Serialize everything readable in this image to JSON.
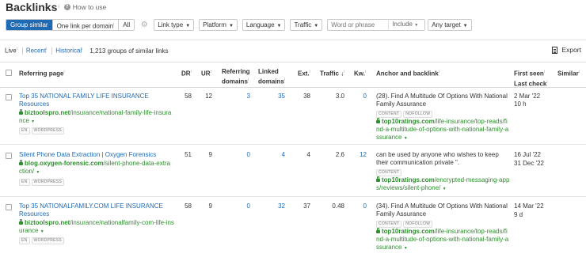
{
  "header": {
    "title": "Backlinks",
    "title_sup": "i",
    "howto": "How to use"
  },
  "filters": {
    "segments": [
      "Group similar",
      "One link per domain",
      "All"
    ],
    "link_type": "Link type",
    "platform": "Platform",
    "language": "Language",
    "traffic": "Traffic",
    "search_placeholder": "Word or phrase",
    "include": "Include",
    "any_target": "Any target"
  },
  "subbar": {
    "tabs": [
      "Live",
      "Recent",
      "Historical"
    ],
    "count": "1,213 groups of similar links",
    "export": "Export"
  },
  "columns": {
    "referring_page": "Referring page",
    "dr": "DR",
    "ur": "UR",
    "ref_domains_1": "Referring",
    "ref_domains_2": "domains",
    "linked_1": "Linked",
    "linked_2": "domains",
    "ext": "Ext.",
    "traffic": "Traffic",
    "kw": "Kw.",
    "anchor": "Anchor and backlink",
    "first_seen": "First seen",
    "last_check": "Last check",
    "similar": "Similar"
  },
  "rows": [
    {
      "title": "Top 35 NATIONAL FAMILY LIFE INSURANCE Resources",
      "url_domain": "biztoolspro.net",
      "url_path": "/insurance/national-family-life-insurance",
      "tags": [
        "EN",
        "WORDPRESS"
      ],
      "dr": "58",
      "ur": "12",
      "ref_domains": "3",
      "linked": "35",
      "ext": "38",
      "traffic": "3.0",
      "kw": "0",
      "anchor": "(28). Find A Multitude Of Options With National Family Assurance",
      "anchor_tags": [
        "CONTENT",
        "NOFOLLOW"
      ],
      "target_domain": "top10ratings.com",
      "target_path": "/life-insurance/top-reads/find-a-multitude-of-options-with-national-family-assurance",
      "first_seen": "2 Mar '22",
      "last_check": "10 h"
    },
    {
      "title": "Silent Phone Data Extraction | Oxygen Forensics",
      "url_domain": "blog.oxygen-forensic.com",
      "url_path": "/silent-phone-data-extraction/",
      "tags": [
        "EN",
        "WORDPRESS"
      ],
      "dr": "51",
      "ur": "9",
      "ref_domains": "0",
      "linked": "4",
      "ext": "4",
      "traffic": "2.6",
      "kw": "12",
      "anchor": "can be used by anyone who wishes to keep their communication private \".",
      "anchor_tags": [
        "CONTENT"
      ],
      "target_domain": "top10ratings.com",
      "target_path": "/encrypted-messaging-apps/reviews/silent-phone/",
      "first_seen": "16 Jul '22",
      "last_check": "31 Dec '22"
    },
    {
      "title": "Top 35 NATIONALFAMILY.COM LIFE INSURANCE Resources",
      "url_domain": "biztoolspro.net",
      "url_path": "/insurance/nationalfamily-com-life-insurance",
      "tags": [
        "EN",
        "WORDPRESS"
      ],
      "dr": "58",
      "ur": "9",
      "ref_domains": "0",
      "linked": "32",
      "ext": "37",
      "traffic": "0.48",
      "kw": "0",
      "anchor": "(34). Find A Multitude Of Options With National Family Assurance",
      "anchor_tags": [
        "CONTENT",
        "NOFOLLOW"
      ],
      "target_domain": "top10ratings.com",
      "target_path": "/life-insurance/top-reads/find-a-multitude-of-options-with-national-family-assurance",
      "first_seen": "14 Mar '22",
      "last_check": "9 d"
    }
  ]
}
